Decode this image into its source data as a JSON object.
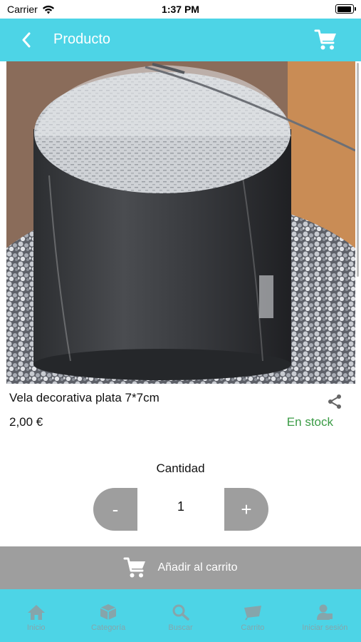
{
  "status_bar": {
    "carrier": "Carrier",
    "time": "1:37 PM"
  },
  "nav": {
    "title": "Producto",
    "back_icon": "chevron-left-icon",
    "cart_icon": "cart-icon"
  },
  "product": {
    "name": "Vela decorativa plata 7*7cm",
    "price": "2,00 €",
    "stock": "En stock",
    "stock_color": "#3a9b45"
  },
  "quantity": {
    "label": "Cantidad",
    "value": "1",
    "minus_label": "-",
    "plus_label": "+"
  },
  "add_to_cart": {
    "label": "Añadir al carrito"
  },
  "tabs": [
    {
      "label": "Inicio",
      "icon": "home-icon"
    },
    {
      "label": "Categoría",
      "icon": "cube-icon"
    },
    {
      "label": "Buscar",
      "icon": "search-icon"
    },
    {
      "label": "Carrito",
      "icon": "cart-icon"
    },
    {
      "label": "Iniciar sesión",
      "icon": "user-icon"
    }
  ],
  "colors": {
    "accent": "#4dd4e6",
    "button_gray": "#9e9e9e",
    "tab_inactive": "#86a5ab"
  }
}
